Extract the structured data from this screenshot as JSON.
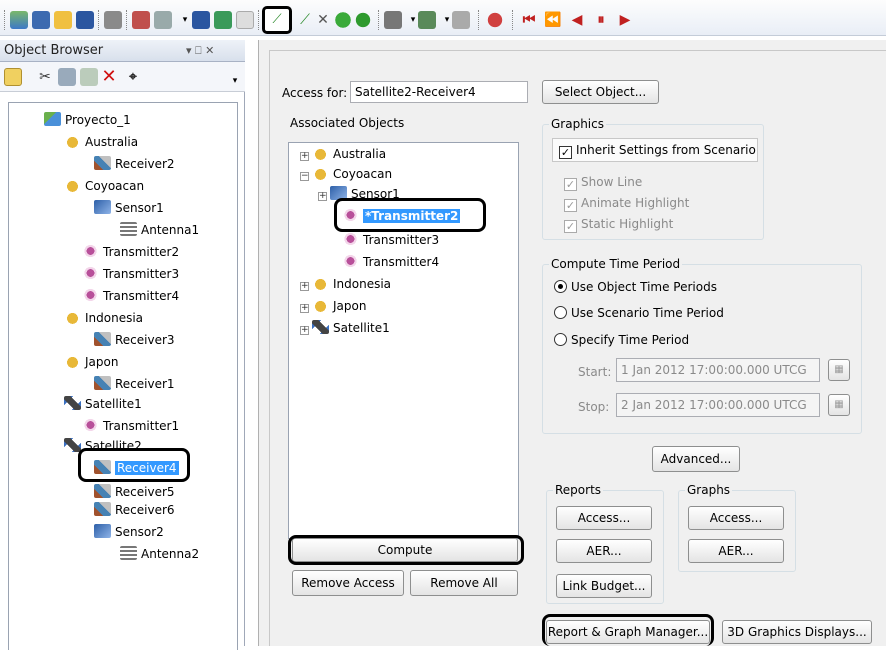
{
  "colors": {
    "selection": "#3399ff",
    "highlight_circle": "#000000"
  },
  "toolbar": {
    "icons": [
      "globe-icon",
      "window-icon",
      "open-folder-icon",
      "save-icon",
      "print-icon",
      "scenario-icon",
      "tools-icon",
      "report-icon",
      "web-icon",
      "close-icon",
      "access-icon",
      "line-icon",
      "tools-x-icon",
      "globe-green-icon",
      "zoom-icon",
      "chart-icon",
      "chart-2-icon",
      "chart-3-icon",
      "globe-3d-icon",
      "rewind-icon",
      "step-back-icon",
      "play-back-icon",
      "pause-icon",
      "play-icon"
    ]
  },
  "browser": {
    "title": "Object Browser",
    "pin": "▾  ⎕  ✕",
    "tree": [
      {
        "label": "Proyecto_1",
        "icon": "scenario-icon"
      },
      {
        "label": "Australia",
        "icon": "facility-icon"
      },
      {
        "label": "Receiver2",
        "icon": "receiver-icon"
      },
      {
        "label": "Coyoacan",
        "icon": "facility-icon"
      },
      {
        "label": "Sensor1",
        "icon": "sensor-icon"
      },
      {
        "label": "Antenna1",
        "icon": "antenna-icon"
      },
      {
        "label": "Transmitter2",
        "icon": "transmitter-icon"
      },
      {
        "label": "Transmitter3",
        "icon": "transmitter-icon"
      },
      {
        "label": "Transmitter4",
        "icon": "transmitter-icon"
      },
      {
        "label": "Indonesia",
        "icon": "facility-icon"
      },
      {
        "label": "Receiver3",
        "icon": "receiver-icon"
      },
      {
        "label": "Japon",
        "icon": "facility-icon"
      },
      {
        "label": "Receiver1",
        "icon": "receiver-icon"
      },
      {
        "label": "Satellite1",
        "icon": "satellite-icon"
      },
      {
        "label": "Transmitter1",
        "icon": "transmitter-icon"
      },
      {
        "label": "Satellite2",
        "icon": "satellite-icon"
      },
      {
        "label": "Receiver4",
        "icon": "receiver-icon",
        "selected": true
      },
      {
        "label": "Receiver5",
        "icon": "receiver-icon"
      },
      {
        "label": "Receiver6",
        "icon": "receiver-icon"
      },
      {
        "label": "Sensor2",
        "icon": "sensor-icon"
      },
      {
        "label": "Antenna2",
        "icon": "antenna-icon"
      }
    ]
  },
  "access": {
    "access_for_label": "Access for:",
    "access_for_value": "Satellite2-Receiver4",
    "select_object": "Select Object...",
    "associated_label": "Associated Objects",
    "assoc_tree": [
      {
        "label": "Australia"
      },
      {
        "label": "Coyoacan"
      },
      {
        "label": "Sensor1"
      },
      {
        "label": "*Transmitter2",
        "selected": true
      },
      {
        "label": "Transmitter3"
      },
      {
        "label": "Transmitter4"
      },
      {
        "label": "Indonesia"
      },
      {
        "label": "Japon"
      },
      {
        "label": "Satellite1"
      }
    ],
    "compute": "Compute",
    "remove_access": "Remove Access",
    "remove_all": "Remove All"
  },
  "graphics": {
    "group": "Graphics",
    "inherit": "Inherit Settings from Scenario",
    "show_line": "Show Line",
    "animate_highlight": "Animate Highlight",
    "static_highlight": "Static Highlight"
  },
  "time": {
    "group": "Compute Time Period",
    "use_object": "Use Object Time Periods",
    "use_scenario": "Use Scenario Time Period",
    "specify": "Specify Time Period",
    "start_label": "Start:",
    "start_value": "1 Jan 2012 17:00:00.000 UTCG",
    "stop_label": "Stop:",
    "stop_value": "2 Jan 2012 17:00:00.000 UTCG"
  },
  "advanced": "Advanced...",
  "reports": {
    "group": "Reports",
    "access": "Access...",
    "aer": "AER...",
    "link_budget": "Link Budget..."
  },
  "graphs": {
    "group": "Graphs",
    "access": "Access...",
    "aer": "AER..."
  },
  "bottom": {
    "report_manager": "Report & Graph Manager...",
    "graphics_3d": "3D Graphics Displays..."
  }
}
